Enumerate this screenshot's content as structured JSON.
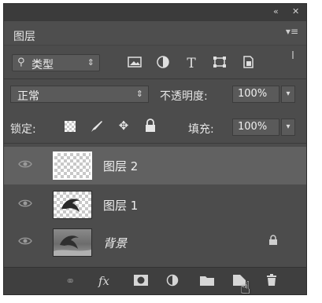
{
  "titlebar": {
    "collapse_icon": "double-chevron-icon",
    "close_label": "✕"
  },
  "panel": {
    "title": "图层",
    "menu_icon": "panel-menu-icon"
  },
  "filter": {
    "kind_label": "类型",
    "icons": [
      "image-filter-icon",
      "adjustment-filter-icon",
      "type-filter-icon",
      "shape-filter-icon",
      "smart-object-filter-icon"
    ],
    "type_glyph": "T"
  },
  "blend": {
    "mode": "正常",
    "opacity_label": "不透明度:",
    "opacity_value": "100%"
  },
  "lock": {
    "label": "锁定:",
    "fill_label": "填充:",
    "fill_value": "100%"
  },
  "layers": [
    {
      "name": "图层 2",
      "selected": true,
      "thumb": "transparent"
    },
    {
      "name": "图层 1",
      "selected": false,
      "thumb": "dolphin-on-transparent"
    },
    {
      "name": "背景",
      "selected": false,
      "thumb": "dolphin-photo",
      "locked": true
    }
  ],
  "bottom_bar": {
    "fx_label": "fx"
  },
  "colors": {
    "panel_bg": "#4c4c4c",
    "selected_row": "#616161",
    "text": "#e6e6e6"
  }
}
